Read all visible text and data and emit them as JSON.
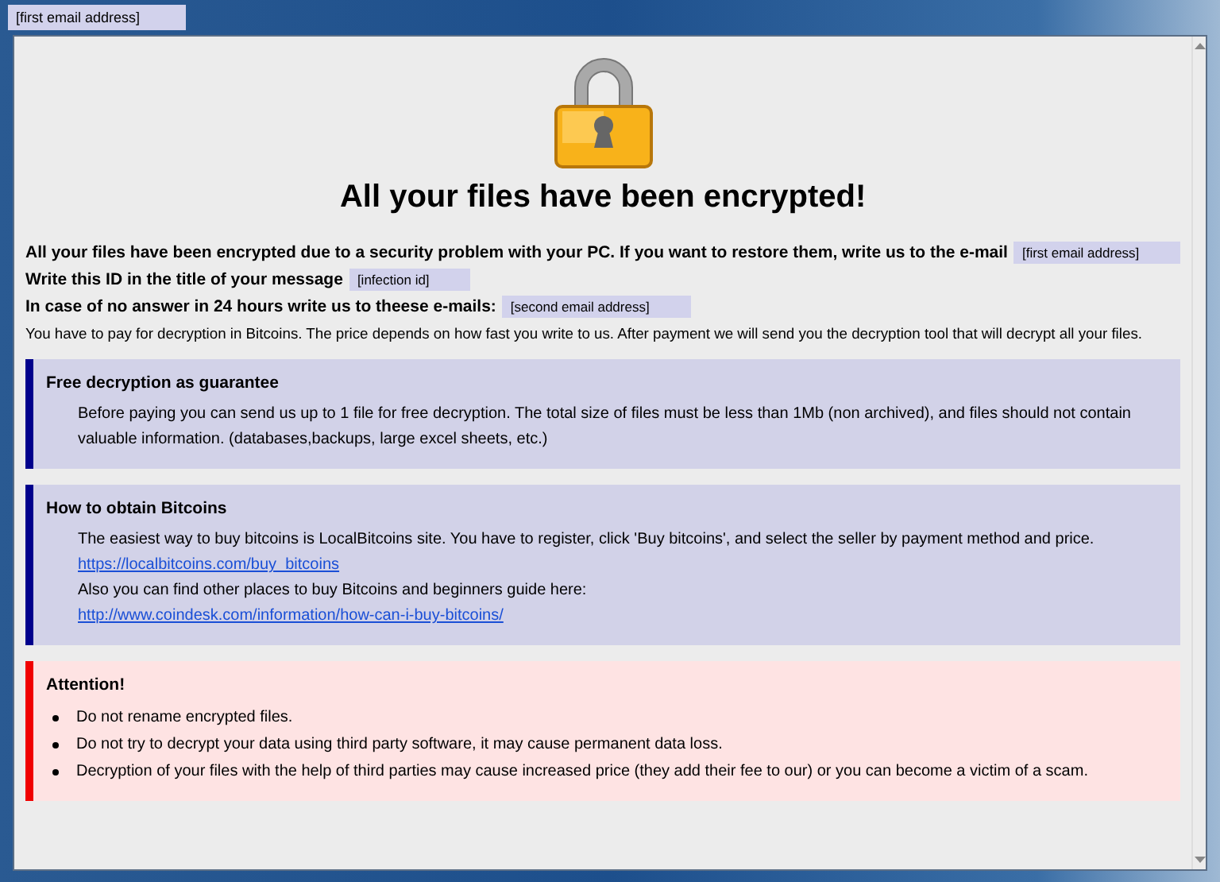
{
  "window": {
    "title": "[first email address]"
  },
  "heading": "All your files have been encrypted!",
  "intro": [
    {
      "kind": "field",
      "text": "All your files have been encrypted due to a security problem with your PC. If you want to restore them, write us to the e-mail",
      "value": "[first email address]"
    },
    {
      "kind": "field",
      "text": "Write this ID in the title of your message",
      "value": "[infection id]"
    },
    {
      "kind": "field",
      "text": "In case of no answer in 24 hours write us to theese e-mails:",
      "value": "[second email address]"
    },
    {
      "kind": "plain",
      "text": "You have to pay for decryption in Bitcoins. The price depends on how fast you write to us. After payment we will send you the decryption tool that will decrypt all your files."
    }
  ],
  "sections": [
    {
      "kind": "info",
      "title": "Free decryption as guarantee",
      "lines": [
        {
          "kind": "text",
          "text": "Before paying you can send us up to 1 file for free decryption. The total size of files must be less than 1Mb (non archived), and files should not contain valuable information. (databases,backups, large excel sheets, etc.)"
        }
      ]
    },
    {
      "kind": "info",
      "title": "How to obtain Bitcoins",
      "lines": [
        {
          "kind": "text",
          "text": "The easiest way to buy bitcoins is LocalBitcoins site. You have to register, click 'Buy bitcoins', and select the seller by payment method and price."
        },
        {
          "kind": "link",
          "text": "https://localbitcoins.com/buy_bitcoins"
        },
        {
          "kind": "text",
          "text": "Also you can find other places to buy Bitcoins and beginners guide here:"
        },
        {
          "kind": "link",
          "text": "http://www.coindesk.com/information/how-can-i-buy-bitcoins/"
        }
      ]
    },
    {
      "kind": "warning",
      "title": "Attention!",
      "lines": [
        {
          "kind": "bullet",
          "text": "Do not rename encrypted files."
        },
        {
          "kind": "bullet",
          "text": "Do not try to decrypt your data using third party software, it may cause permanent data loss."
        },
        {
          "kind": "bullet",
          "text": "Decryption of your files with the help of third parties may cause increased price (they add their fee to our) or you can become a victim of a scam."
        }
      ]
    }
  ]
}
